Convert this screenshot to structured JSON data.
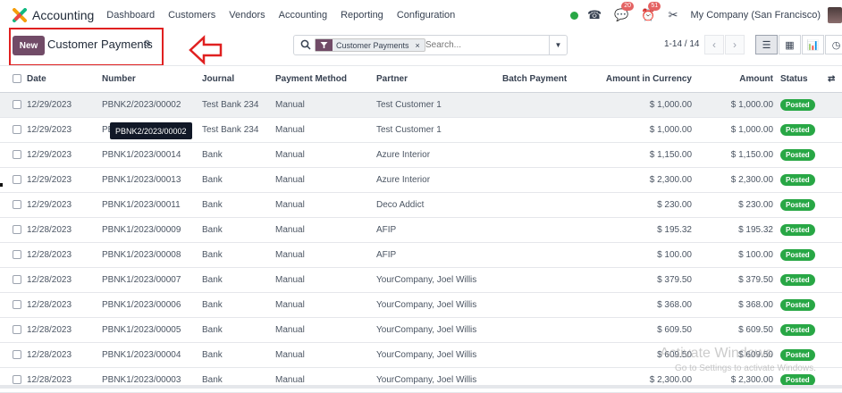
{
  "app": {
    "name": "Accounting",
    "brand_color": "#714b67"
  },
  "menu": [
    "Dashboard",
    "Customers",
    "Vendors",
    "Accounting",
    "Reporting",
    "Configuration"
  ],
  "systray": {
    "status_color": "#28a745",
    "messages_count": "20",
    "activities_count": "51",
    "company": "My Company (San Francisco)"
  },
  "controls": {
    "new_label": "New",
    "title": "Customer Payments",
    "facet_label": "Customer Payments",
    "facet_remove": "×",
    "search_placeholder": "Search...",
    "pager": "1-14 / 14"
  },
  "table": {
    "columns": [
      "Date",
      "Number",
      "Journal",
      "Payment Method",
      "Partner",
      "Batch Payment",
      "Amount in Currency",
      "Amount",
      "Status"
    ],
    "rows": [
      {
        "date": "12/29/2023",
        "number": "PBNK2/2023/00002",
        "journal": "Test Bank 234",
        "method": "Manual",
        "partner": "Test Customer 1",
        "batch": "",
        "amount_currency": "$ 1,000.00",
        "amount": "$ 1,000.00",
        "status": "Posted"
      },
      {
        "date": "12/29/2023",
        "number": "PBNK2/2023/00001",
        "journal": "Test Bank 234",
        "method": "Manual",
        "partner": "Test Customer 1",
        "batch": "",
        "amount_currency": "$ 1,000.00",
        "amount": "$ 1,000.00",
        "status": "Posted"
      },
      {
        "date": "12/29/2023",
        "number": "PBNK1/2023/00014",
        "journal": "Bank",
        "method": "Manual",
        "partner": "Azure Interior",
        "batch": "",
        "amount_currency": "$ 1,150.00",
        "amount": "$ 1,150.00",
        "status": "Posted"
      },
      {
        "date": "12/29/2023",
        "number": "PBNK1/2023/00013",
        "journal": "Bank",
        "method": "Manual",
        "partner": "Azure Interior",
        "batch": "",
        "amount_currency": "$ 2,300.00",
        "amount": "$ 2,300.00",
        "status": "Posted"
      },
      {
        "date": "12/29/2023",
        "number": "PBNK1/2023/00011",
        "journal": "Bank",
        "method": "Manual",
        "partner": "Deco Addict",
        "batch": "",
        "amount_currency": "$ 230.00",
        "amount": "$ 230.00",
        "status": "Posted"
      },
      {
        "date": "12/28/2023",
        "number": "PBNK1/2023/00009",
        "journal": "Bank",
        "method": "Manual",
        "partner": "AFIP",
        "batch": "",
        "amount_currency": "$ 195.32",
        "amount": "$ 195.32",
        "status": "Posted"
      },
      {
        "date": "12/28/2023",
        "number": "PBNK1/2023/00008",
        "journal": "Bank",
        "method": "Manual",
        "partner": "AFIP",
        "batch": "",
        "amount_currency": "$ 100.00",
        "amount": "$ 100.00",
        "status": "Posted"
      },
      {
        "date": "12/28/2023",
        "number": "PBNK1/2023/00007",
        "journal": "Bank",
        "method": "Manual",
        "partner": "YourCompany, Joel Willis",
        "batch": "",
        "amount_currency": "$ 379.50",
        "amount": "$ 379.50",
        "status": "Posted"
      },
      {
        "date": "12/28/2023",
        "number": "PBNK1/2023/00006",
        "journal": "Bank",
        "method": "Manual",
        "partner": "YourCompany, Joel Willis",
        "batch": "",
        "amount_currency": "$ 368.00",
        "amount": "$ 368.00",
        "status": "Posted"
      },
      {
        "date": "12/28/2023",
        "number": "PBNK1/2023/00005",
        "journal": "Bank",
        "method": "Manual",
        "partner": "YourCompany, Joel Willis",
        "batch": "",
        "amount_currency": "$ 609.50",
        "amount": "$ 609.50",
        "status": "Posted"
      },
      {
        "date": "12/28/2023",
        "number": "PBNK1/2023/00004",
        "journal": "Bank",
        "method": "Manual",
        "partner": "YourCompany, Joel Willis",
        "batch": "",
        "amount_currency": "$ 609.50",
        "amount": "$ 609.50",
        "status": "Posted"
      },
      {
        "date": "12/28/2023",
        "number": "PBNK1/2023/00003",
        "journal": "Bank",
        "method": "Manual",
        "partner": "YourCompany, Joel Willis",
        "batch": "",
        "amount_currency": "$ 2,300.00",
        "amount": "$ 2,300.00",
        "status": "Posted"
      }
    ]
  },
  "tooltip": "PBNK2/2023/00002",
  "watermark": {
    "title": "Activate Windows",
    "subtitle": "Go to Settings to activate Windows."
  }
}
